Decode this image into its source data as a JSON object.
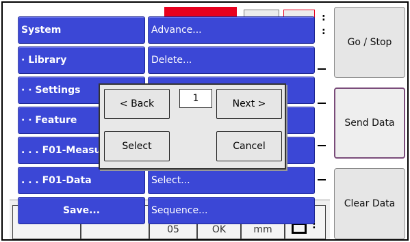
{
  "softkeys": [
    {
      "label": "Go / Stop"
    },
    {
      "label": "Send Data"
    },
    {
      "label": "Clear Data"
    }
  ],
  "menu": {
    "left": [
      {
        "label": "System"
      },
      {
        "label": "· Library"
      },
      {
        "label": "· · Settings"
      },
      {
        "label": "· · Feature"
      },
      {
        "label": ". . . F01-Measu"
      },
      {
        "label": ". . . F01-Data"
      },
      {
        "label": "Save..."
      }
    ],
    "right": [
      {
        "label": "Advance..."
      },
      {
        "label": "Delete..."
      },
      {
        "label": ""
      },
      {
        "label": ""
      },
      {
        "label": ""
      },
      {
        "label": "Select..."
      },
      {
        "label": "Sequence..."
      }
    ]
  },
  "dialog": {
    "back_label": "< Back",
    "page_value": "1",
    "next_label": "Next >",
    "select_label": "Select",
    "cancel_label": "Cancel"
  },
  "background": {
    "bottom_cells": [
      "",
      "",
      "05",
      "OK",
      "mm",
      ""
    ],
    "colors": {
      "menu_blue": "#3b47d6",
      "alert_red": "#e8001e"
    }
  }
}
